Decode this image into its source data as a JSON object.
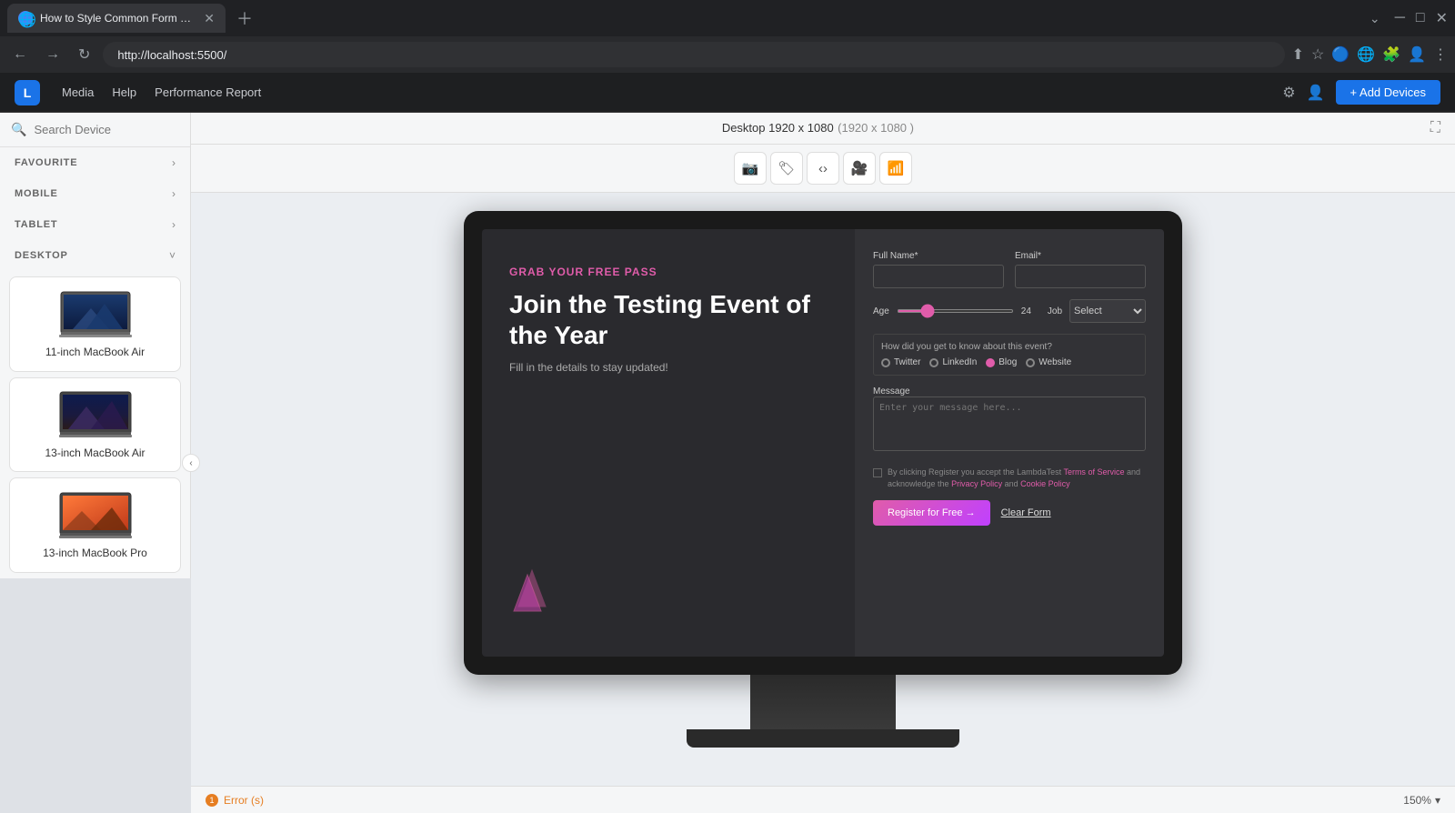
{
  "browser": {
    "tab_title": "How to Style Common Form Ele...",
    "url": "http://localhost:5500/",
    "tab_favicon": "🌐"
  },
  "app": {
    "nav_items": [
      "Media",
      "Help",
      "Performance Report"
    ],
    "add_devices_label": "+ Add Devices"
  },
  "sidebar": {
    "search_placeholder": "Search Device",
    "sections": [
      {
        "id": "favourite",
        "label": "FAVOURITE",
        "expanded": false
      },
      {
        "id": "mobile",
        "label": "MOBILE",
        "expanded": false
      },
      {
        "id": "tablet",
        "label": "TABLET",
        "expanded": false
      },
      {
        "id": "desktop",
        "label": "DESKTOP",
        "expanded": true
      }
    ],
    "devices": [
      {
        "name": "11-inch MacBook Air",
        "size": "11"
      },
      {
        "name": "13-inch MacBook Air",
        "size": "13a"
      },
      {
        "name": "13-inch MacBook Pro",
        "size": "13p"
      }
    ]
  },
  "device_info": {
    "title": "Desktop 1920 x 1080",
    "dimensions": "(1920 x 1080 )"
  },
  "form_preview": {
    "grab_text": "GRAB YOUR FREE PASS",
    "heading": "Join the Testing Event of the Year",
    "subtext": "Fill in the details to stay updated!",
    "full_name_label": "Full Name*",
    "email_label": "Email*",
    "age_label": "Age",
    "age_value": "24",
    "job_label": "Job",
    "job_placeholder": "Select",
    "know_title": "How did you get to know about this event?",
    "radio_options": [
      "Twitter",
      "LinkedIn",
      "Blog",
      "Website"
    ],
    "selected_radio": "Blog",
    "message_label": "Message",
    "message_placeholder": "Enter your message here...",
    "terms_text": "By clicking Register you accept the LambdaTest Terms of Service and acknowledge the Privacy Policy and Cookie Policy",
    "register_btn": "Register for Free →",
    "clear_btn": "Clear Form"
  },
  "status": {
    "error_count": "1",
    "error_label": "Error (s)",
    "zoom": "150%"
  }
}
